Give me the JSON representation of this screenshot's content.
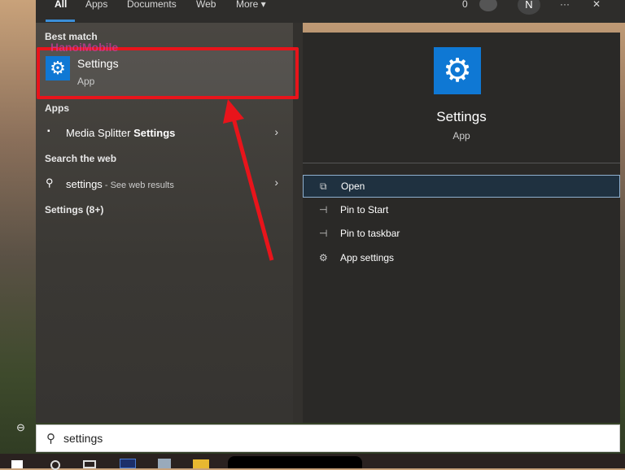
{
  "tabs": [
    {
      "label": "All"
    },
    {
      "label": "Apps"
    },
    {
      "label": "Documents"
    },
    {
      "label": "Web"
    },
    {
      "label": "More ▾"
    }
  ],
  "top_right": {
    "points": "0",
    "avatar": "N",
    "more": "···",
    "close": "✕"
  },
  "watermark": "HanoiMobile",
  "left": {
    "best_match_header": "Best match",
    "best_match": {
      "title": "Settings",
      "subtitle": "App"
    },
    "apps_header": "Apps",
    "apps": [
      {
        "prefix": "Media Splitter ",
        "bold": "Settings"
      }
    ],
    "web_header": "Search the web",
    "web": {
      "query": "settings",
      "suffix": " - See web results"
    },
    "settings_header": "Settings (8+)"
  },
  "right": {
    "title": "Settings",
    "subtitle": "App",
    "actions": [
      {
        "label": "Open",
        "icon": "open-icon"
      },
      {
        "label": "Pin to Start",
        "icon": "pin-icon"
      },
      {
        "label": "Pin to taskbar",
        "icon": "pin-icon"
      },
      {
        "label": "App settings",
        "icon": "gear-icon"
      }
    ]
  },
  "search": {
    "value": "settings"
  },
  "colors": {
    "accent": "#0f78d4",
    "highlight": "#e8141b"
  }
}
